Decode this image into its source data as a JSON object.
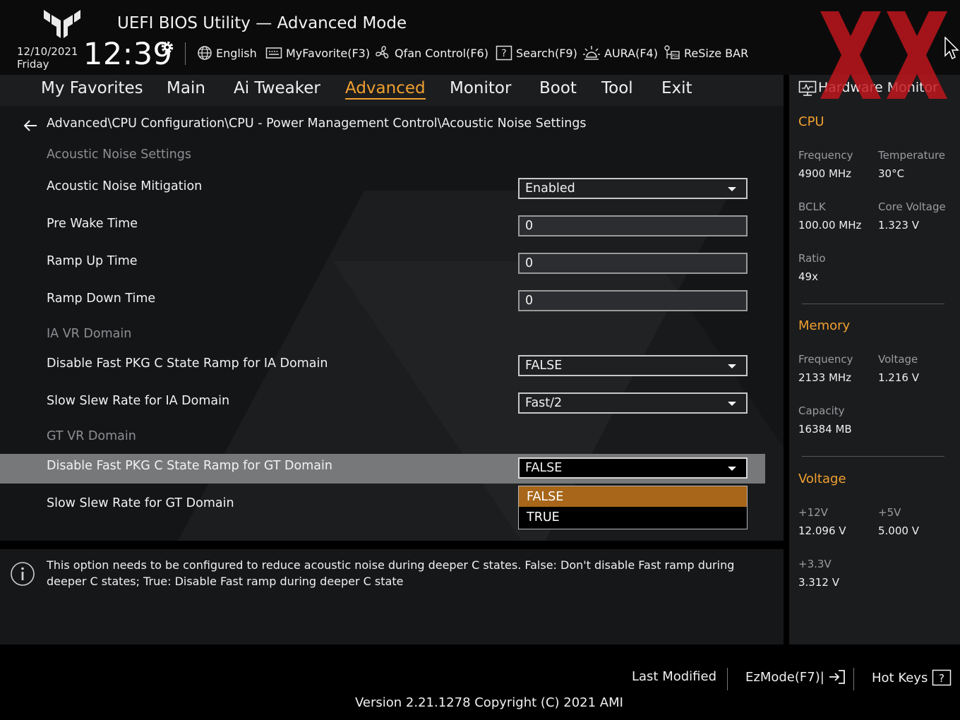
{
  "header": {
    "title": "UEFI BIOS Utility — Advanced Mode",
    "date": "12/10/2021",
    "day": "Friday",
    "time": "12:39",
    "toolbar": {
      "language": "English",
      "my_favorite": "MyFavorite(F3)",
      "qfan": "Qfan Control(F6)",
      "search": "Search(F9)",
      "aura": "AURA(F4)",
      "resize_bar": "ReSize BAR"
    }
  },
  "nav": {
    "tabs": [
      {
        "label": "My Favorites"
      },
      {
        "label": "Main"
      },
      {
        "label": "Ai Tweaker"
      },
      {
        "label": "Advanced"
      },
      {
        "label": "Monitor"
      },
      {
        "label": "Boot"
      },
      {
        "label": "Tool"
      },
      {
        "label": "Exit"
      }
    ],
    "active": "Advanced"
  },
  "breadcrumb": "Advanced\\CPU Configuration\\CPU - Power Management Control\\Acoustic Noise Settings",
  "settings": {
    "section_acoustic": "Acoustic Noise Settings",
    "acoustic_mitigation": {
      "label": "Acoustic Noise Mitigation",
      "value": "Enabled"
    },
    "pre_wake": {
      "label": "Pre Wake Time",
      "value": "0"
    },
    "ramp_up": {
      "label": "Ramp Up Time",
      "value": "0"
    },
    "ramp_down": {
      "label": "Ramp Down Time",
      "value": "0"
    },
    "section_ia": "IA VR Domain",
    "ia_disable_fast": {
      "label": "Disable Fast PKG C State Ramp for IA Domain",
      "value": "FALSE"
    },
    "ia_slew": {
      "label": "Slow Slew Rate for IA Domain",
      "value": "Fast/2"
    },
    "section_gt": "GT VR Domain",
    "gt_disable_fast": {
      "label": "Disable Fast PKG C State Ramp for GT Domain",
      "value": "FALSE"
    },
    "gt_slew": {
      "label": "Slow Slew Rate for GT Domain"
    }
  },
  "dropdown": {
    "options": [
      "FALSE",
      "TRUE"
    ],
    "selected": "FALSE"
  },
  "help_text": "This option needs to be configured to reduce acoustic noise during deeper C states. False: Don't disable Fast ramp during deeper C states; True: Disable Fast ramp during deeper C state",
  "hardware_monitor": {
    "title": "Hardware Monitor",
    "cpu": {
      "heading": "CPU",
      "frequency_label": "Frequency",
      "frequency": "4900 MHz",
      "temperature_label": "Temperature",
      "temperature": "30°C",
      "bclk_label": "BCLK",
      "bclk": "100.00 MHz",
      "core_voltage_label": "Core Voltage",
      "core_voltage": "1.323 V",
      "ratio_label": "Ratio",
      "ratio": "49x"
    },
    "memory": {
      "heading": "Memory",
      "frequency_label": "Frequency",
      "frequency": "2133 MHz",
      "voltage_label": "Voltage",
      "voltage": "1.216 V",
      "capacity_label": "Capacity",
      "capacity": "16384 MB"
    },
    "voltage": {
      "heading": "Voltage",
      "v12_label": "+12V",
      "v12": "12.096 V",
      "v5_label": "+5V",
      "v5": "5.000 V",
      "v33_label": "+3.3V",
      "v33": "3.312 V"
    }
  },
  "footer": {
    "last_modified": "Last Modified",
    "ezmode": "EzMode(F7)|",
    "hot_keys": "Hot Keys",
    "version": "Version 2.21.1278 Copyright (C) 2021 AMI"
  },
  "colors": {
    "accent": "#f0a030",
    "selected_option": "#a7661a",
    "selected_row": "#77787a",
    "watermark": "#c4161c"
  }
}
